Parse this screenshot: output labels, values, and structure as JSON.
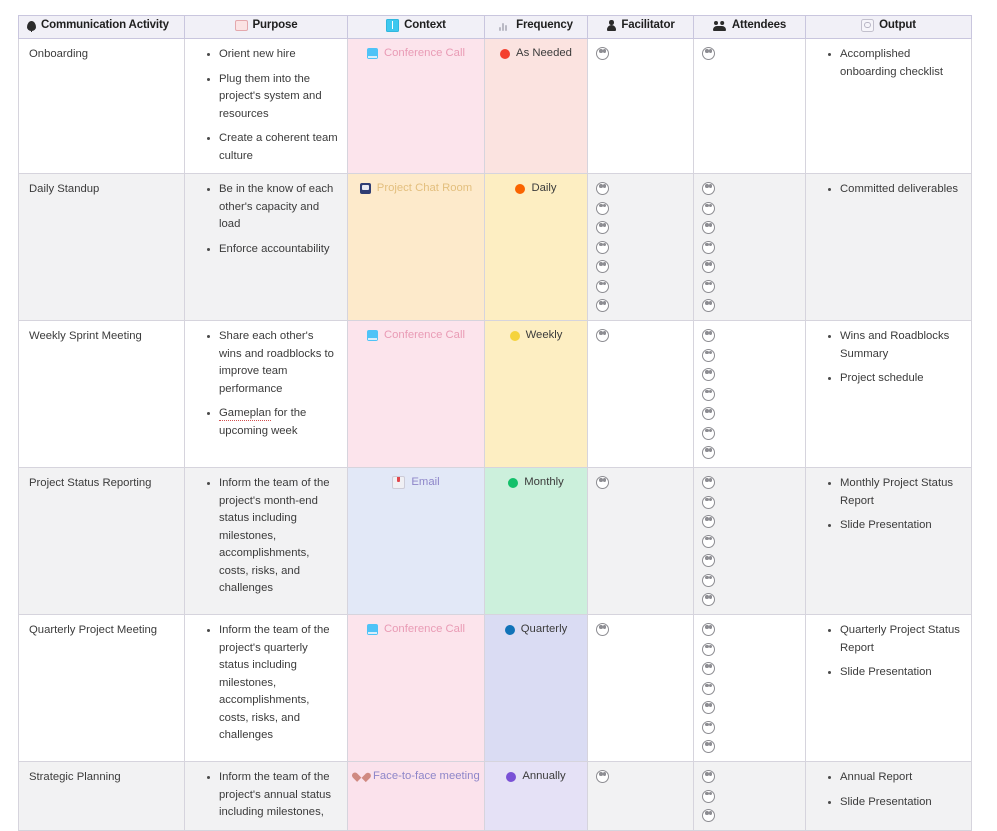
{
  "table": {
    "columns": [
      {
        "key": "activity",
        "label": "Communication Activity",
        "icon": "pin-icon"
      },
      {
        "key": "purpose",
        "label": "Purpose",
        "icon": "note-icon"
      },
      {
        "key": "context",
        "label": "Context",
        "icon": "book-icon"
      },
      {
        "key": "frequency",
        "label": "Frequency",
        "icon": "waveform-icon"
      },
      {
        "key": "facilitator",
        "label": "Facilitator",
        "icon": "person-icon"
      },
      {
        "key": "attendees",
        "label": "Attendees",
        "icon": "people-icon"
      },
      {
        "key": "output",
        "label": "Output",
        "icon": "output-icon"
      }
    ],
    "rows": [
      {
        "activity": "Onboarding",
        "purpose": [
          "Orient new hire",
          "Plug them into the project's system and resources",
          "Create a coherent team culture"
        ],
        "context": {
          "label": "Conference Call",
          "icon": "screen-icon",
          "color": "#e99bb5",
          "bg": "#fce4ec"
        },
        "frequency": {
          "label": "As Needed",
          "dot": "#f43f2e",
          "bg": "#fbe3e0"
        },
        "facilitator_count": 1,
        "attendees_count": 1,
        "output": [
          "Accomplished onboarding checklist"
        ]
      },
      {
        "activity": "Daily Standup",
        "purpose": [
          "Be in the know of each other's capacity and load",
          "Enforce accountability"
        ],
        "context": {
          "label": "Project Chat Room",
          "icon": "chat-icon",
          "color": "#e3bf7e",
          "bg": "#fdeacb"
        },
        "frequency": {
          "label": "Daily",
          "dot": "#fa6400",
          "bg": "#fdeec2"
        },
        "facilitator_count": 7,
        "attendees_count": 7,
        "output": [
          "Committed deliverables"
        ]
      },
      {
        "activity": "Weekly Sprint Meeting",
        "purpose": [
          "Share each other's wins and roadblocks to improve team performance",
          "Gameplan for the upcoming week"
        ],
        "purpose_misspelled": "Gameplan",
        "context": {
          "label": "Conference Call",
          "icon": "screen-icon",
          "color": "#e99bb5",
          "bg": "#fce4ec"
        },
        "frequency": {
          "label": "Weekly",
          "dot": "#f5d33d",
          "bg": "#fdeec2"
        },
        "facilitator_count": 1,
        "attendees_count": 7,
        "output": [
          "Wins and Roadblocks Summary",
          "Project schedule"
        ]
      },
      {
        "activity": "Project Status Reporting",
        "purpose": [
          "Inform the team of the project's month-end status including milestones, accomplishments, costs, risks, and challenges"
        ],
        "context": {
          "label": "Email",
          "icon": "mail-icon",
          "color": "#8e86c9",
          "bg": "#e2e8f7"
        },
        "frequency": {
          "label": "Monthly",
          "dot": "#13c06a",
          "bg": "#ccf0dc"
        },
        "facilitator_count": 1,
        "attendees_count": 7,
        "output": [
          "Monthly Project Status Report",
          "Slide Presentation"
        ]
      },
      {
        "activity": "Quarterly Project Meeting",
        "purpose": [
          "Inform the team of the project's quarterly status including milestones, accomplishments, costs, risks, and challenges"
        ],
        "context": {
          "label": "Conference Call",
          "icon": "screen-icon",
          "color": "#e99bb5",
          "bg": "#fce4ec"
        },
        "frequency": {
          "label": "Quarterly",
          "dot": "#1073b8",
          "bg": "#dadcf3"
        },
        "facilitator_count": 1,
        "attendees_count": 7,
        "output": [
          "Quarterly Project Status Report",
          "Slide Presentation"
        ]
      },
      {
        "activity": "Strategic Planning",
        "purpose": [
          "Inform the team of the project's annual status including milestones,"
        ],
        "context": {
          "label": "Face-to-face meeting",
          "icon": "heart-icon",
          "color": "#8e86c9",
          "bg": "#fbe2ec"
        },
        "frequency": {
          "label": "Annually",
          "dot": "#7a51d6",
          "bg": "#e5e1f6"
        },
        "facilitator_count": 1,
        "attendees_count": 3,
        "output": [
          "Annual Report",
          "Slide Presentation"
        ]
      }
    ]
  }
}
